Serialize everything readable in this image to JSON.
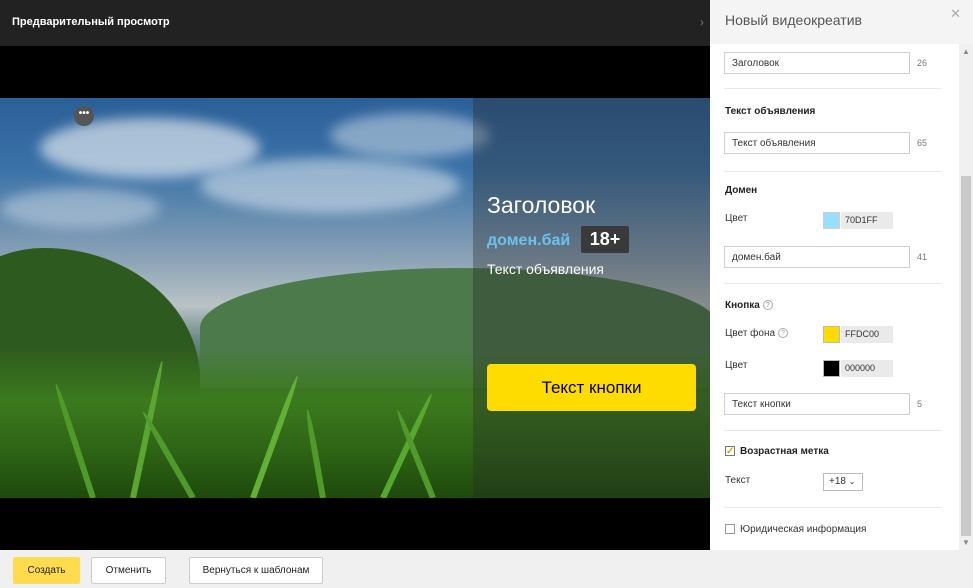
{
  "preview": {
    "title": "Предварительный просмотр",
    "more_label": "•••"
  },
  "ad": {
    "title": "Заголовок",
    "domain": "домен.бай",
    "age_mark": "18+",
    "text": "Текст объявления",
    "button": "Текст кнопки",
    "domain_color": "#70D1FF",
    "button_bg": "#FFDC00",
    "button_color": "#000000"
  },
  "panel": {
    "title": "Новый видеокреатив",
    "headline": {
      "value": "Заголовок",
      "count": "26"
    },
    "ad_text": {
      "section": "Текст объявления",
      "value": "Текст объявления",
      "count": "65"
    },
    "domain": {
      "section": "Домен",
      "color_label": "Цвет",
      "color_hex": "70D1FF",
      "value": "домен.бай",
      "count": "41"
    },
    "button": {
      "section": "Кнопка",
      "bg_label": "Цвет фона",
      "bg_hex": "FFDC00",
      "color_label": "Цвет",
      "color_hex": "000000",
      "value": "Текст кнопки",
      "count": "5"
    },
    "age": {
      "label": "Возрастная метка",
      "checked": true,
      "text_label": "Текст",
      "selected": "+18"
    },
    "legal": {
      "label": "Юридическая информация",
      "checked": false
    }
  },
  "footer": {
    "create": "Создать",
    "cancel": "Отменить",
    "back": "Вернуться к шаблонам"
  }
}
